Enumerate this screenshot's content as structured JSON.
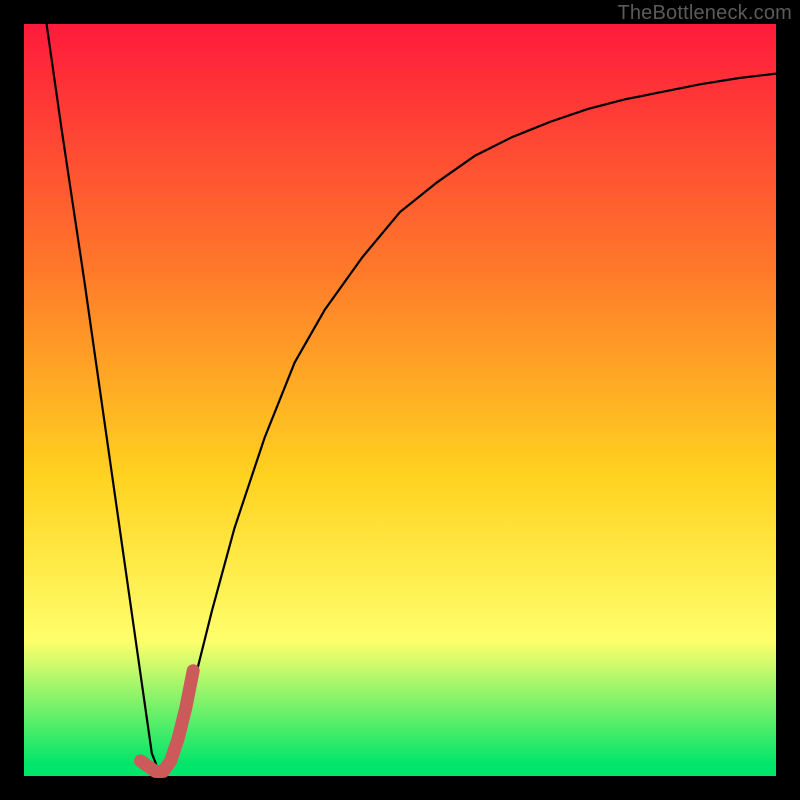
{
  "watermark": {
    "text": "TheBottleneck.com"
  },
  "colors": {
    "frame": "#000000",
    "gradient_top": "#ff1a3c",
    "gradient_mid1": "#ff7a2a",
    "gradient_mid2": "#ffd21f",
    "gradient_mid3": "#ffff6b",
    "gradient_bottom": "#00e56a",
    "curve_stroke": "#000000",
    "highlight_stroke": "#cc5a5a",
    "watermark_text": "#5b5b5b"
  },
  "gradient_stops": [
    {
      "offset": 0.0,
      "color_key": "gradient_top"
    },
    {
      "offset": 0.33,
      "color_key": "gradient_mid1"
    },
    {
      "offset": 0.6,
      "color_key": "gradient_mid2"
    },
    {
      "offset": 0.82,
      "color_key": "gradient_mid3"
    },
    {
      "offset": 0.985,
      "color_key": "gradient_bottom"
    }
  ],
  "chart_data": {
    "type": "line",
    "title": "",
    "xlabel": "",
    "ylabel": "",
    "xlim": [
      0,
      100
    ],
    "ylim": [
      0,
      100
    ],
    "grid": false,
    "legend": false,
    "series": [
      {
        "name": "bottleneck-curve",
        "role": "main",
        "color_key": "curve_stroke",
        "stroke_width": 2.2,
        "x": [
          3,
          5,
          8,
          10,
          12,
          14,
          16,
          17,
          18,
          20,
          22,
          25,
          28,
          32,
          36,
          40,
          45,
          50,
          55,
          60,
          65,
          70,
          75,
          80,
          85,
          90,
          95,
          100
        ],
        "y": [
          100,
          86,
          66,
          52,
          38,
          24,
          10,
          3,
          0.5,
          4,
          10,
          22,
          33,
          45,
          55,
          62,
          69,
          75,
          79,
          82.5,
          85,
          87,
          88.7,
          90,
          91,
          92,
          92.8,
          93.4
        ]
      },
      {
        "name": "optimal-region",
        "role": "highlight",
        "color_key": "highlight_stroke",
        "stroke_width": 13,
        "linecap": "round",
        "x": [
          15.5,
          17.5,
          18.5,
          19.5,
          20.5,
          21.5,
          22.5
        ],
        "y": [
          2.0,
          0.6,
          0.6,
          2.0,
          5.0,
          9.0,
          14.0
        ]
      }
    ]
  }
}
